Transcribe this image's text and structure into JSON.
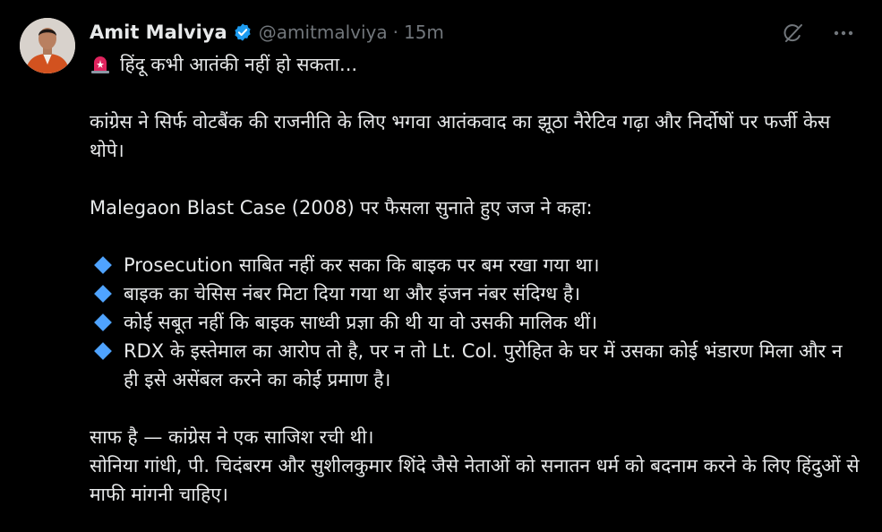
{
  "author": {
    "name": "Amit Malviya",
    "handle": "@amitmalviya",
    "separator": "·",
    "time": "15m"
  },
  "colors": {
    "background": "#000000",
    "text": "#e7e9ea",
    "muted": "#71767b",
    "verified": "#1d9bf0",
    "bullet": "#4fa3ff",
    "siren": "#e0245e"
  },
  "icons": {
    "siren": "rotating-light-icon",
    "grok": "grok-icon",
    "more": "more-icon",
    "verified": "verified-badge-icon",
    "bullet": "blue-diamond-icon"
  },
  "tweet": {
    "line1": "हिंदू कभी आतंकी नहीं हो सकता...",
    "para1": "कांग्रेस ने सिर्फ वोटबैंक की राजनीति के लिए भगवा आतंकवाद का झूठा नैरेटिव गढ़ा और निर्दोषों पर फर्जी केस थोपे।",
    "para2": "Malegaon Blast Case (2008) पर फैसला सुनाते हुए जज ने कहा:",
    "bullets": [
      "Prosecution साबित नहीं कर सका कि बाइक पर बम रखा गया था।",
      "बाइक का चेसिस नंबर मिटा दिया गया था और इंजन नंबर संदिग्ध है।",
      "कोई सबूत नहीं कि बाइक साध्वी प्रज्ञा की थी या वो उसकी मालिक थीं।",
      "RDX के इस्तेमाल का आरोप तो है, पर न तो Lt. Col. पुरोहित के घर में उसका कोई भंडारण मिला और न ही इसे असेंबल करने का कोई प्रमाण है।"
    ],
    "para3_line1": "साफ है — कांग्रेस ने एक साजिश रची थी।",
    "para3_line2": "सोनिया गांधी, पी. चिदंबरम और सुशीलकुमार शिंदे जैसे नेताओं को सनातन धर्म को बदनाम करने के लिए हिंदुओं से माफी मांगनी चाहिए।"
  }
}
